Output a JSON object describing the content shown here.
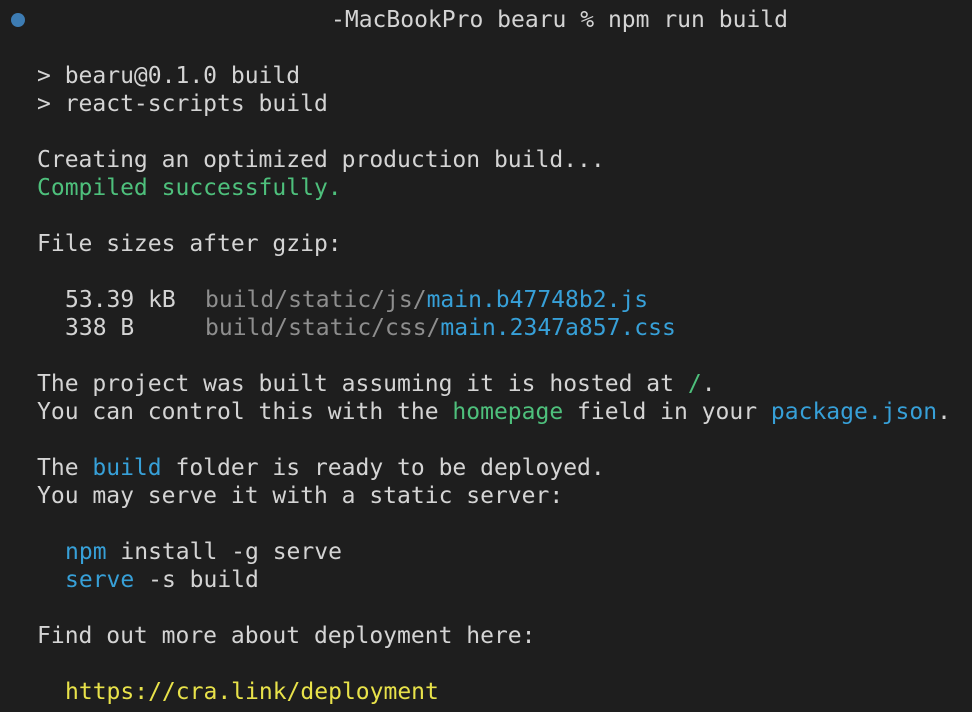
{
  "terminal": {
    "prompt": "-MacBookPro bearu % npm run build",
    "lines": {
      "l1": "> bearu@0.1.0 build",
      "l2": "> react-scripts build",
      "l3": "Creating an optimized production build...",
      "l4": "Compiled successfully.",
      "l5": "File sizes after gzip:"
    },
    "files": [
      {
        "size": "53.39 kB",
        "dir": "build/static/js/",
        "name": "main.b47748b2.js"
      },
      {
        "size": "338 B",
        "dir": "build/static/css/",
        "name": "main.2347a857.css"
      }
    ],
    "hosted": {
      "prefix": "The project was built assuming it is hosted at ",
      "path": "/",
      "suffix": "."
    },
    "control": {
      "p1": "You can control this with the ",
      "homepage": "homepage",
      "p2": " field in your ",
      "pkg": "package.json",
      "p3": "."
    },
    "build_folder": {
      "p1": "The ",
      "build": "build",
      "p2": " folder is ready to be deployed."
    },
    "serve_hint": "You may serve it with a static server:",
    "cmd1": {
      "bin": "npm",
      "args": " install -g serve"
    },
    "cmd2": {
      "bin": "serve",
      "args": " -s build"
    },
    "deploy_hint": "Find out more about deployment here:",
    "deploy_url": "https://cra.link/deployment"
  },
  "colors": {
    "background": "#1e1e1e",
    "text": "#d4d4d4",
    "success": "#4ec07c",
    "link": "#37a0d8",
    "muted": "#8e8e8e",
    "url": "#e8e24a"
  }
}
